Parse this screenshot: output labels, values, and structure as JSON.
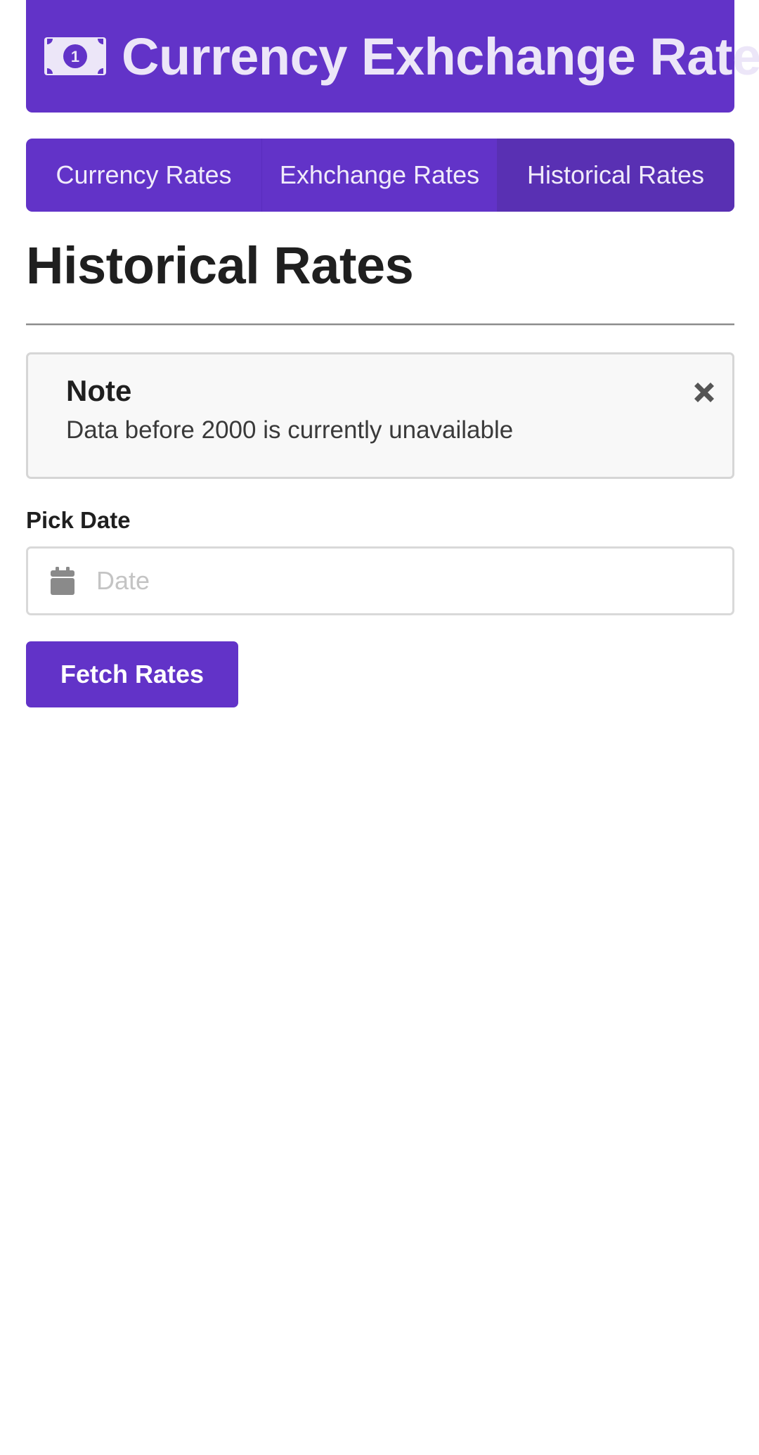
{
  "header": {
    "icon": "money-bill-icon",
    "title": "Currency Exhchange Rate"
  },
  "tabs": [
    {
      "label": "Currency Rates",
      "active": false
    },
    {
      "label": "Exhchange Rates",
      "active": false
    },
    {
      "label": "Historical Rates",
      "active": true
    }
  ],
  "page_title": "Historical Rates",
  "note": {
    "title": "Note",
    "text": "Data before 2000 is currently unavailable",
    "close_icon": "close-icon"
  },
  "date_field": {
    "label": "Pick Date",
    "placeholder": "Date",
    "value": "",
    "icon": "calendar-icon"
  },
  "fetch_button": {
    "label": "Fetch Rates"
  },
  "colors": {
    "primary": "#6233c8",
    "active_tab": "#5930b3",
    "note_bg": "#f8f8f8"
  }
}
